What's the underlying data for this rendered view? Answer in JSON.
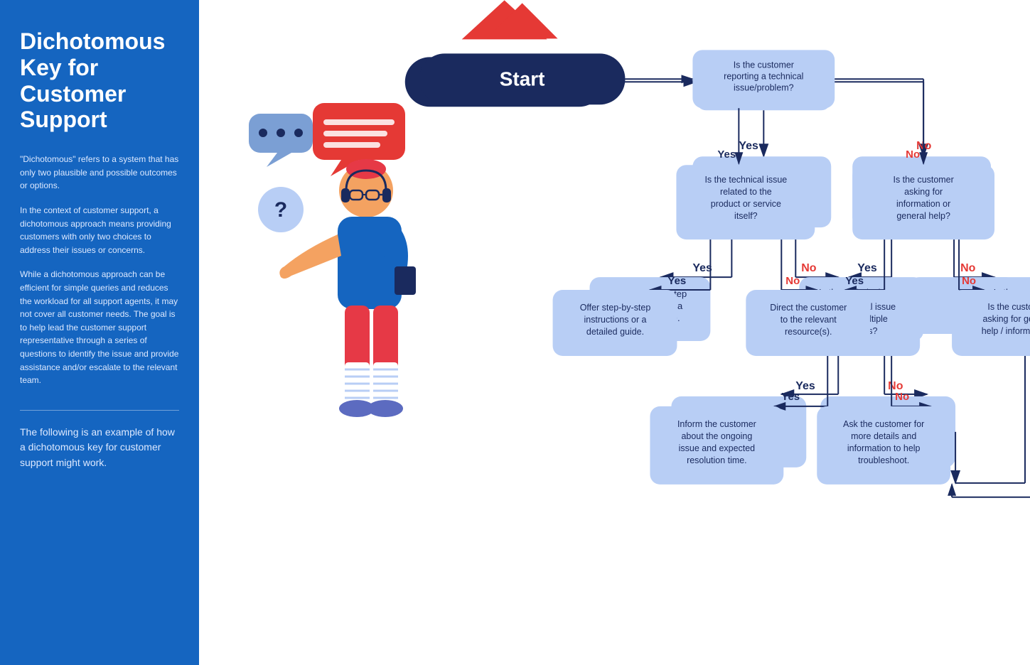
{
  "sidebar": {
    "title": "Dichotomous Key for Customer Support",
    "para1": "\"Dichotomous\" refers to a system that has only two plausible and possible outcomes or options.",
    "para2": "In the context of customer support, a dichotomous approach means providing customers with only two choices to address their issues or concerns.",
    "para3": "While a dichotomous approach can be efficient for simple queries and reduces the workload for all support agents, it may not cover all customer needs. The goal is to help lead the customer support representative through a series of questions to identify the issue and provide assistance and/or escalate to the relevant team.",
    "bottom_text": "The following is an example of how a dichotomous key for customer support might work."
  },
  "flowchart": {
    "start_label": "Start",
    "nodes": {
      "q1": "Is the customer reporting a technical issue/problem?",
      "q2": "Is the technical issue related to the product or service itself?",
      "q3": "Is the customer asking for information or general help?",
      "a1": "Offer step-by-step instructions or a detailed guide.",
      "q4": "Is the technical issue affecting multiple customers?",
      "a2": "Direct the customer to the relevant resource(s).",
      "q5": "Is the customer asking for general help / information?",
      "a3": "Inform the customer about the ongoing issue and expected resolution time.",
      "a4": "Ask the customer for more details and information to help troubleshoot.",
      "yes": "Yes",
      "no": "No"
    }
  }
}
